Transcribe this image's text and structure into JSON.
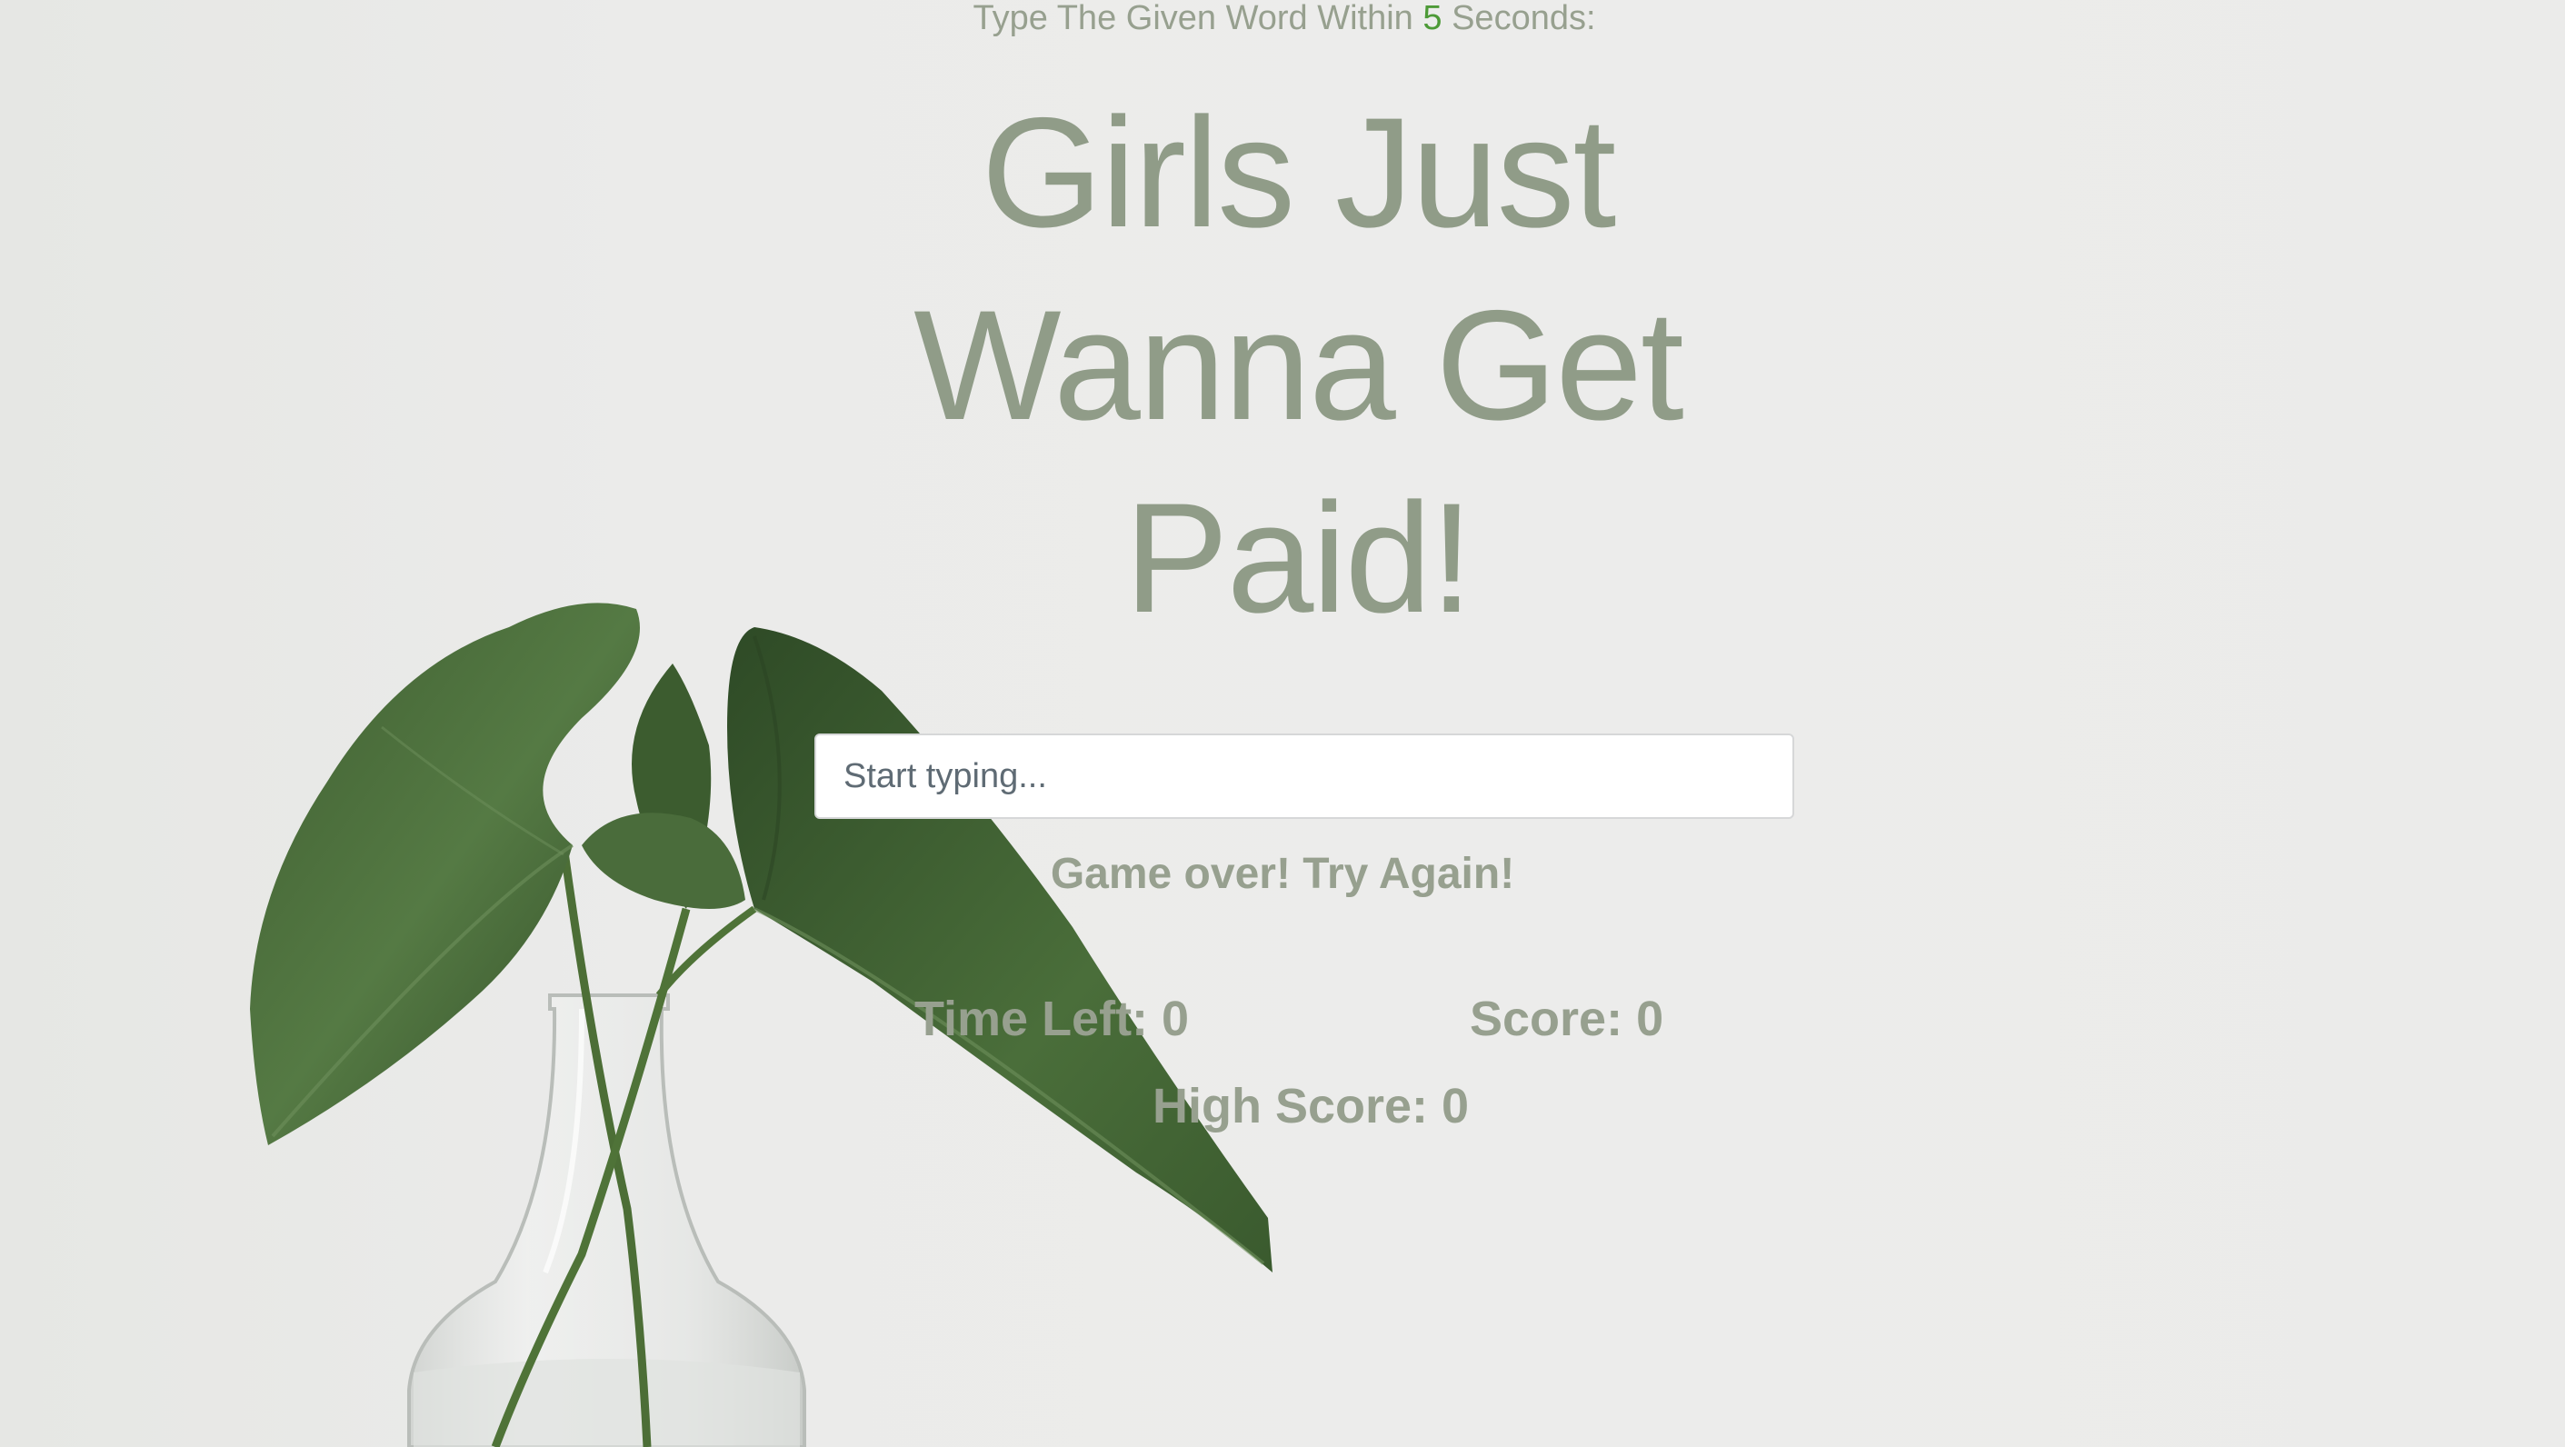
{
  "instruction": {
    "prefix": "Type The Given Word Within ",
    "seconds": "5",
    "suffix": " Seconds:"
  },
  "current_word": "Girls Just Wanna Get Paid!",
  "input": {
    "placeholder": "Start typing...",
    "value": ""
  },
  "message": "Game over! Try Again!",
  "stats": {
    "time_left_label": "Time Left: ",
    "time_left_value": "0",
    "score_label": "Score: ",
    "score_value": "0",
    "high_score_label": "High Score: ",
    "high_score_value": "0"
  },
  "colors": {
    "background": "#ebebea",
    "text": "#97a08f",
    "word": "#909c88",
    "seconds_accent": "#4d9a37",
    "leaf": "#4b6b3c"
  }
}
